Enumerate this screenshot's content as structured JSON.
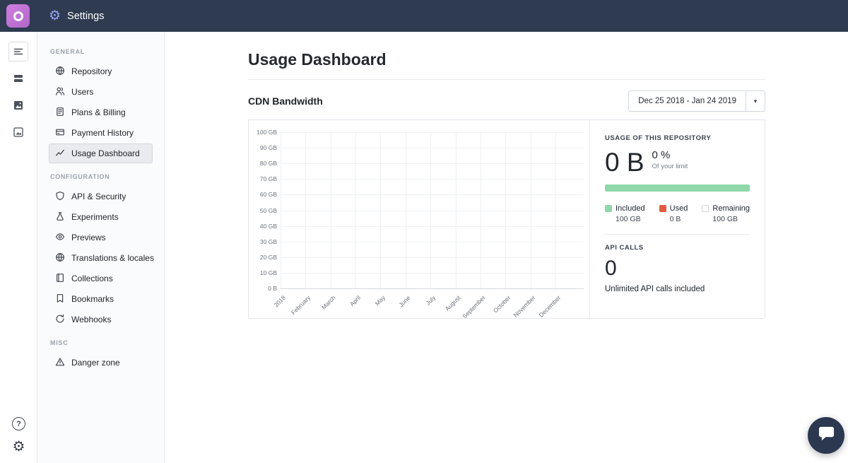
{
  "topbar": {
    "title": "Settings"
  },
  "icon_rail": {
    "top": [
      "content-lines-icon",
      "rows-icon",
      "media-image-icon",
      "framed-image-icon"
    ],
    "bottom": [
      "help-icon",
      "settings-gear-icon"
    ]
  },
  "sidebar": {
    "sections": [
      {
        "label": "GENERAL",
        "items": [
          {
            "label": "Repository",
            "icon": "globe-icon"
          },
          {
            "label": "Users",
            "icon": "users-icon"
          },
          {
            "label": "Plans & Billing",
            "icon": "invoice-icon"
          },
          {
            "label": "Payment History",
            "icon": "credit-card-icon"
          },
          {
            "label": "Usage Dashboard",
            "icon": "chart-line-icon",
            "selected": true
          }
        ]
      },
      {
        "label": "CONFIGURATION",
        "items": [
          {
            "label": "API & Security",
            "icon": "shield-icon"
          },
          {
            "label": "Experiments",
            "icon": "flask-icon"
          },
          {
            "label": "Previews",
            "icon": "eye-icon"
          },
          {
            "label": "Translations & locales",
            "icon": "globe-icon"
          },
          {
            "label": "Collections",
            "icon": "book-icon"
          },
          {
            "label": "Bookmarks",
            "icon": "bookmark-icon"
          },
          {
            "label": "Webhooks",
            "icon": "refresh-icon"
          }
        ]
      },
      {
        "label": "MISC",
        "items": [
          {
            "label": "Danger zone",
            "icon": "warning-icon"
          }
        ]
      }
    ]
  },
  "main": {
    "title": "Usage Dashboard",
    "section_heading": "CDN Bandwidth",
    "date_range": {
      "label": "Dec 25 2018 - Jan 24 2019",
      "caret": "▾"
    },
    "usage": {
      "heading": "USAGE OF THIS REPOSITORY",
      "value": "0 B",
      "percent": "0 %",
      "percent_caption": "Of your limit",
      "progress_percent": 100,
      "legend": [
        {
          "label": "Included",
          "value": "100 GB",
          "color": "#8fd8a8"
        },
        {
          "label": "Used",
          "value": "0 B",
          "color": "#e2593f"
        },
        {
          "label": "Remaining",
          "value": "100 GB",
          "color": "#ffffff"
        }
      ]
    },
    "api": {
      "heading": "API CALLS",
      "value": "0",
      "caption": "Unlimited API calls included"
    }
  },
  "chart_data": {
    "type": "line",
    "title": "CDN Bandwidth",
    "categories": [
      "2018",
      "February",
      "March",
      "April",
      "May",
      "June",
      "July",
      "August",
      "September",
      "October",
      "November",
      "December"
    ],
    "values": [
      0,
      0,
      0,
      0,
      0,
      0,
      0,
      0,
      0,
      0,
      0,
      0
    ],
    "y_ticks": [
      "0 B",
      "10 GB",
      "20 GB",
      "30 GB",
      "40 GB",
      "50 GB",
      "60 GB",
      "70 GB",
      "80 GB",
      "90 GB",
      "100 GB"
    ],
    "ylim": [
      0,
      100
    ],
    "ylabel": "",
    "xlabel": "",
    "grid": true,
    "legend_position": "right-panel"
  },
  "colors": {
    "topbar_bg": "#2e3b51",
    "logo": "#bf72d5",
    "accent_green": "#8fd8a8",
    "used_red": "#e2593f"
  }
}
